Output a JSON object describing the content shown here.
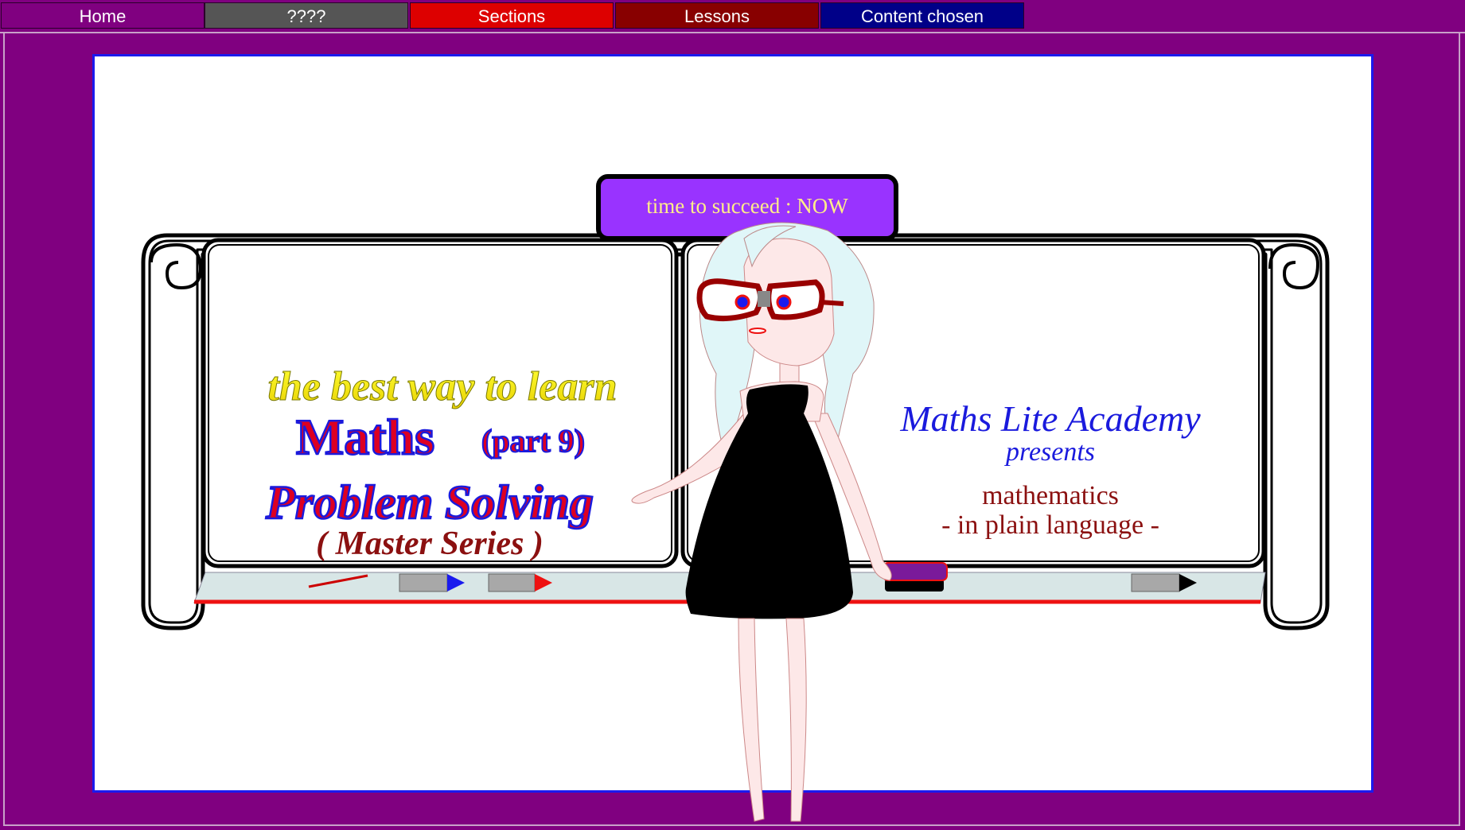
{
  "nav": {
    "items": [
      {
        "label": "Home",
        "color": "#800080"
      },
      {
        "label": "????",
        "color": "#555555"
      },
      {
        "label": "Sections",
        "color": "#dd0000"
      },
      {
        "label": "Lessons",
        "color": "#880000"
      },
      {
        "label": "Content chosen",
        "color": "#000088"
      }
    ]
  },
  "banner": {
    "text": "time to succeed : NOW"
  },
  "left_board": {
    "line1": "the best way to learn",
    "line2": "Maths",
    "line2_part": "(part 9)",
    "line3": "Problem Solving",
    "line4": "( Master Series )"
  },
  "right_board": {
    "line1": "Maths Lite Academy",
    "line2": "presents",
    "line3": "mathematics",
    "line4": "- in plain language -"
  },
  "colors": {
    "background": "#800080",
    "stage": "#ffffff",
    "stage_border": "#1a1aee",
    "banner": "#9933ff",
    "banner_text": "#ffee88",
    "tagline": "#ffff00",
    "blue_text": "#1a1add",
    "red_text": "#dd0022",
    "dark_red": "#8b1010"
  }
}
